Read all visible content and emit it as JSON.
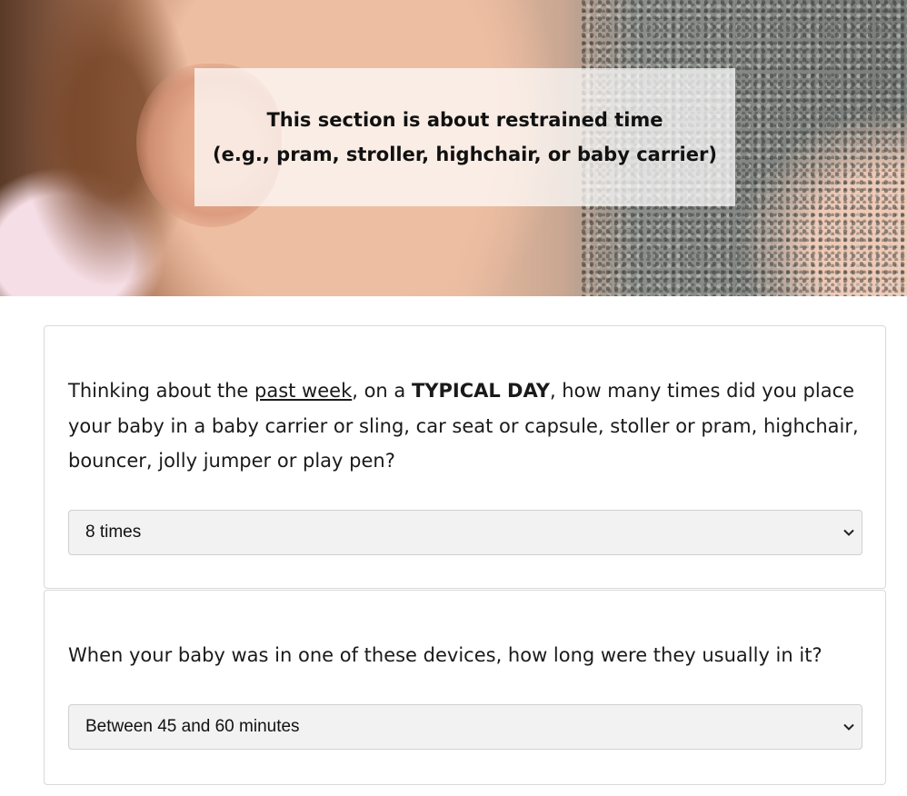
{
  "hero": {
    "line1": "This section is about restrained time",
    "line2": "(e.g., pram, stroller, highchair, or baby carrier)"
  },
  "q1": {
    "text_a": "Thinking about the ",
    "emphasis_underline": "past week",
    "text_b": ", on a ",
    "emphasis_bold": "TYPICAL DAY",
    "text_c": ", how many times did you place your baby in a baby carrier or sling, car seat or capsule, stoller or pram, highchair, bouncer, jolly jumper or play pen?",
    "selected": "8 times"
  },
  "q2": {
    "text": "When your baby was in one of these devices, how long were they usually in it?",
    "selected": "Between 45 and 60 minutes"
  },
  "icons": {
    "dropdown": "chevron-down-icon"
  }
}
